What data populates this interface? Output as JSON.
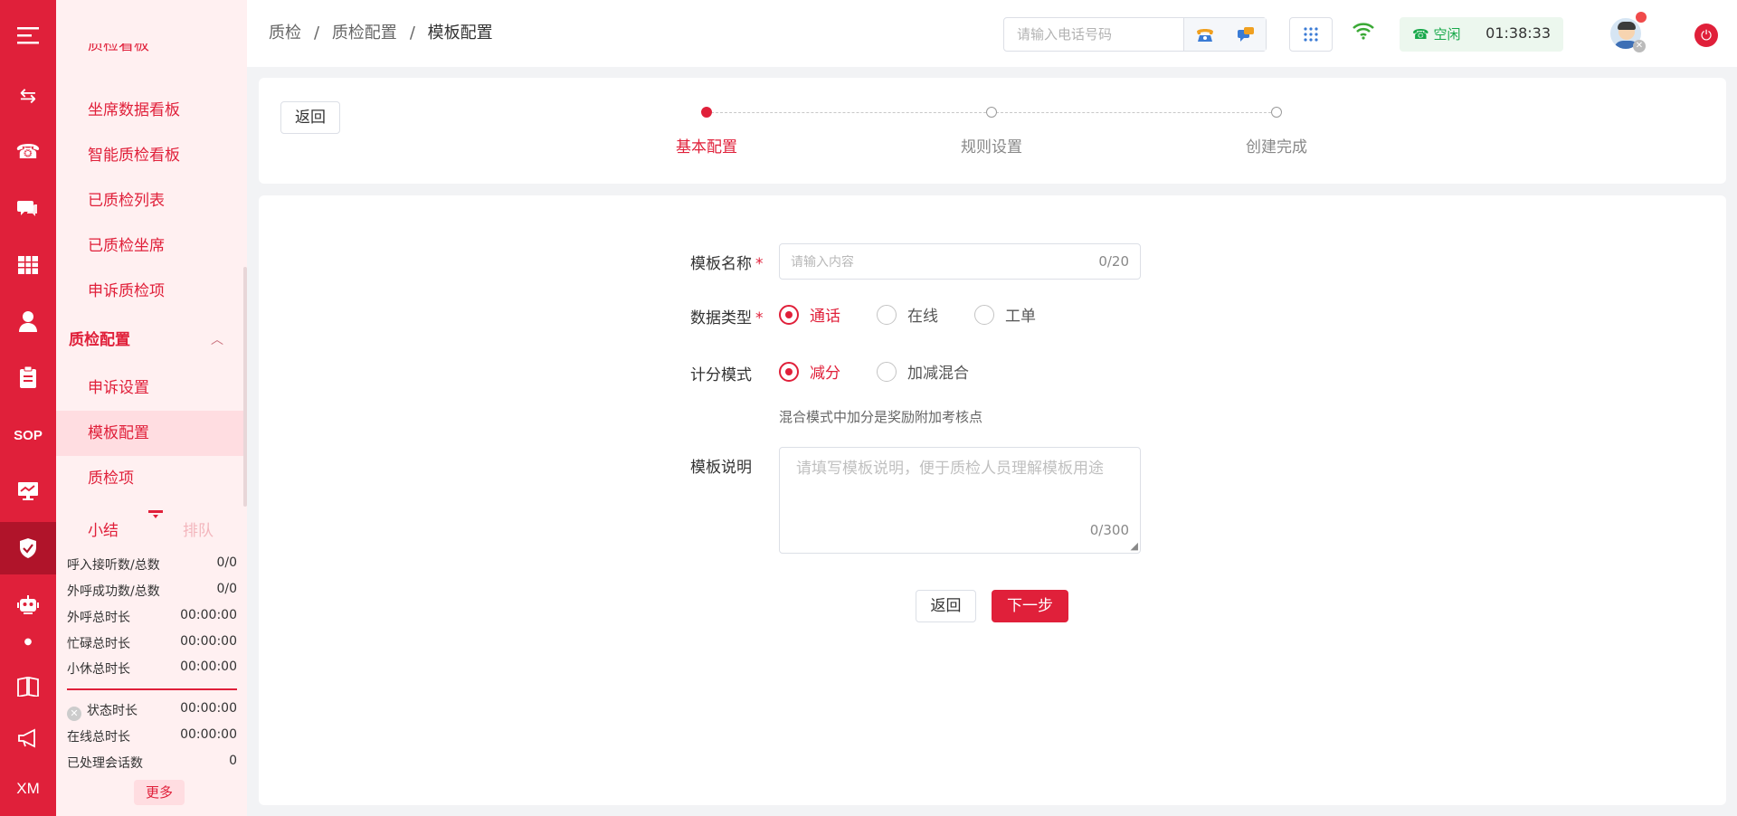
{
  "rail": {
    "icons": [
      "menu-icon",
      "transfer-icon",
      "phone-icon",
      "chat-icon",
      "table-icon",
      "user-icon",
      "clipboard-icon",
      "sop-icon",
      "monitor-icon",
      "shield-check-icon",
      "robot-icon",
      "book-icon",
      "megaphone-icon",
      "xm-icon"
    ],
    "sop_label": "SOP",
    "xm_label": "XM"
  },
  "menu": {
    "partial_item": "质检看板",
    "items_top": [
      "坐席数据看板",
      "智能质检看板",
      "已质检列表",
      "已质检坐席",
      "申诉质检项"
    ],
    "group_label": "质检配置",
    "group_items": [
      "申诉设置",
      "模板配置",
      "质检项"
    ],
    "active_item": "模板配置",
    "tab_summary": "小结",
    "tab_queue": "排队",
    "stats": [
      {
        "k": "呼入接听数/总数",
        "v": "0/0"
      },
      {
        "k": "外呼成功数/总数",
        "v": "0/0"
      },
      {
        "k": "外呼总时长",
        "v": "00:00:00"
      },
      {
        "k": "忙碌总时长",
        "v": "00:00:00"
      },
      {
        "k": "小休总时长",
        "v": "00:00:00"
      }
    ],
    "stats2": [
      {
        "k": "状态时长",
        "v": "00:00:00"
      },
      {
        "k": "在线总时长",
        "v": "00:00:00"
      },
      {
        "k": "已处理会话数",
        "v": "0"
      }
    ],
    "more_label": "更多"
  },
  "header": {
    "breadcrumb": [
      "质检",
      "质检配置",
      "模板配置"
    ],
    "phone_placeholder": "请输入电话号码",
    "status_label": "空闲",
    "timer": "01:38:33"
  },
  "steps": {
    "back_label": "返回",
    "items": [
      "基本配置",
      "规则设置",
      "创建完成"
    ],
    "current": 0
  },
  "form": {
    "name_label": "模板名称",
    "name_placeholder": "请输入内容",
    "name_count": "0/20",
    "type_label": "数据类型",
    "type_options": [
      "通话",
      "在线",
      "工单"
    ],
    "type_selected": "通话",
    "score_label": "计分模式",
    "score_options": [
      "减分",
      "加减混合"
    ],
    "score_selected": "减分",
    "hint": "混合模式中加分是奖励附加考核点",
    "desc_label": "模板说明",
    "desc_placeholder": "请填写模板说明，便于质检人员理解模板用途",
    "desc_count": "0/300",
    "back_label": "返回",
    "next_label": "下一步"
  },
  "colors": {
    "brand": "#e0203a",
    "status_green": "#17a84a"
  }
}
